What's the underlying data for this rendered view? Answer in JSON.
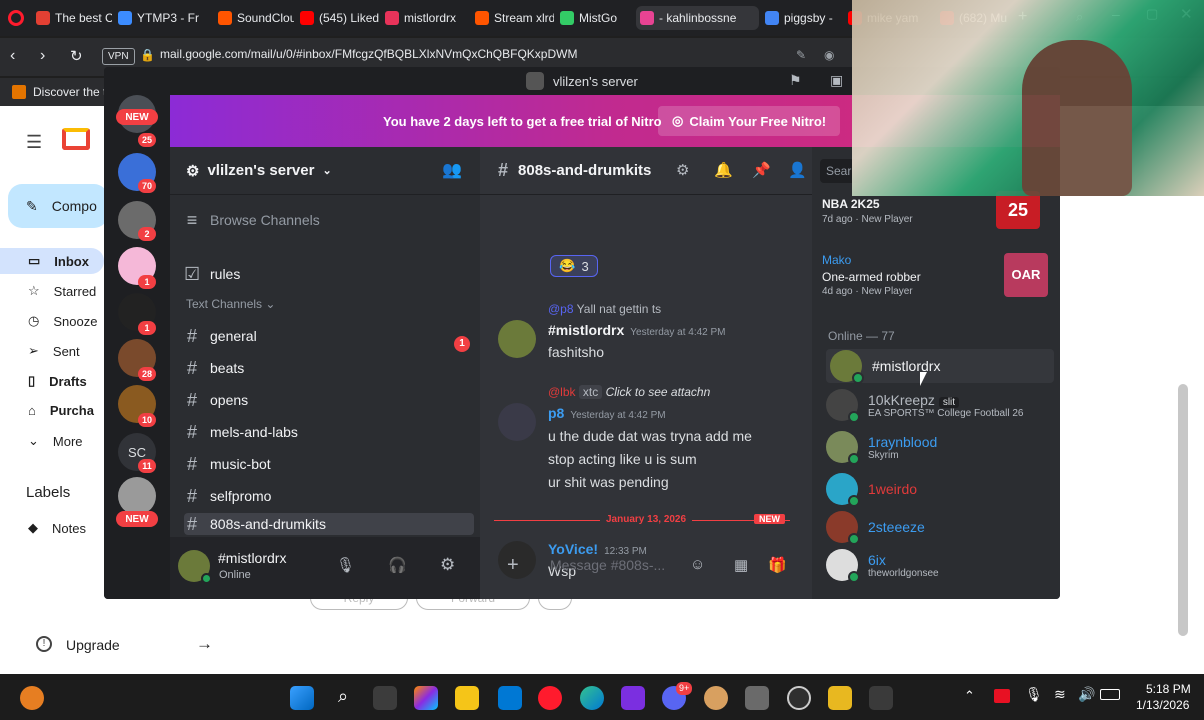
{
  "browser": {
    "tabs": [
      {
        "label": "The best C",
        "color": "#e34033"
      },
      {
        "label": "YTMP3 - Fr",
        "color": "#3c8cff"
      },
      {
        "label": "SoundClou",
        "color": "#ff5500"
      },
      {
        "label": "(545) Liked",
        "color": "#ff0000"
      },
      {
        "label": "mistlordrx",
        "color": "#e8335a"
      },
      {
        "label": "Stream xlrd",
        "color": "#ff5500"
      },
      {
        "label": "MistGo",
        "color": "#33cc66"
      },
      {
        "label": "- kahlinbossne",
        "color": "#e84393"
      },
      {
        "label": "piggsby - ",
        "color": "#4285f4"
      },
      {
        "label": "mike yam",
        "color": "#ff0000"
      },
      {
        "label": "(682) Mu",
        "color": "#ff0000"
      }
    ],
    "url": "mail.google.com/mail/u/0/#inbox/FMfcgzQfBQBLXlxNVmQxChQBFQKxpDWM",
    "vpn_label": "VPN",
    "bookmark": "Discover the t"
  },
  "gmail": {
    "compose": "Compo",
    "nav": [
      "Inbox",
      "Starred",
      "Snooze",
      "Sent",
      "Drafts",
      "Purcha",
      "More"
    ],
    "labels_heading": "Labels",
    "notes": "Notes",
    "upgrade": "Upgrade",
    "ghost_buttons": [
      "Reply",
      "Forward"
    ]
  },
  "discord": {
    "window_title": "vlilzen's server",
    "nitro_banner": "You have 2 days left to get a free trial of Nitro",
    "nitro_cta": "Claim Your Free Nitro!",
    "server_name": "vlilzen's server",
    "browse_channels": "Browse Channels",
    "rules_channel": "rules",
    "text_channels_header": "Text Channels",
    "channels": [
      "general",
      "beats",
      "opens",
      "mels-and-labs",
      "music-bot",
      "selfpromo",
      "808s-and-drumkits"
    ],
    "general_badge": "1",
    "current_channel": "808s-and-drumkits",
    "search_label": "Sear",
    "user": {
      "name": "#mistlordrx",
      "status": "Online"
    },
    "guild_badges": [
      "25",
      "70",
      "2",
      "1",
      "1",
      "28",
      "10",
      "11"
    ],
    "new_label": "NEW",
    "guild_sc": "SC",
    "reaction_count": "3",
    "messages": [
      {
        "reply_to": "@p8",
        "reply_text": "Yall nat gettin ts",
        "author": "#mistlordrx",
        "time": "Yesterday at 4:42 PM",
        "lines": [
          "fashitsho"
        ],
        "color": "#f2f3f5"
      },
      {
        "reply_to": "@lbk",
        "reply_tag": "xtc",
        "reply_text": "Click to see attachn",
        "author": "p8",
        "time": "Yesterday at 4:42 PM",
        "lines": [
          "u the dude dat was tryna add me",
          "stop acting like u is sum",
          "ur shit was pending"
        ],
        "color": "#3c9cf0"
      },
      {
        "author": "YoVice!",
        "time": "12:33 PM",
        "lines": [
          "Wsp"
        ],
        "color": "#3c9cf0"
      }
    ],
    "date_divider": "January 13, 2026",
    "new_marker": "NEW",
    "composer_placeholder": "Message #808s-...",
    "members_top": [
      {
        "name": "NBA 2K25",
        "sub": "7d ago",
        "tag": "New Player",
        "art": "25"
      },
      {
        "name": "Mako",
        "activity": "One-armed robber",
        "sub": "4d ago",
        "tag": "New Player",
        "art": "OAR"
      }
    ],
    "online_header": "Online — 77",
    "members": [
      {
        "name": "#mistlordrx",
        "color": "#f2f3f5",
        "activity": ""
      },
      {
        "name": "10kKreepz",
        "color": "#b5bac1",
        "activity": "EA SPORTS™ College Football 26",
        "tag": "slit"
      },
      {
        "name": "1raynblood",
        "color": "#3c9cf0",
        "activity": "Skyrim"
      },
      {
        "name": "1weirdo",
        "color": "#e03a3a",
        "activity": ""
      },
      {
        "name": "2steeeze",
        "color": "#3c9cf0",
        "activity": ""
      },
      {
        "name": "6ix",
        "color": "#3c9cf0",
        "activity": "theworldgonsee"
      }
    ]
  },
  "taskbar": {
    "time": "5:18 PM",
    "date": "1/13/2026",
    "discord_badge": "9+"
  }
}
